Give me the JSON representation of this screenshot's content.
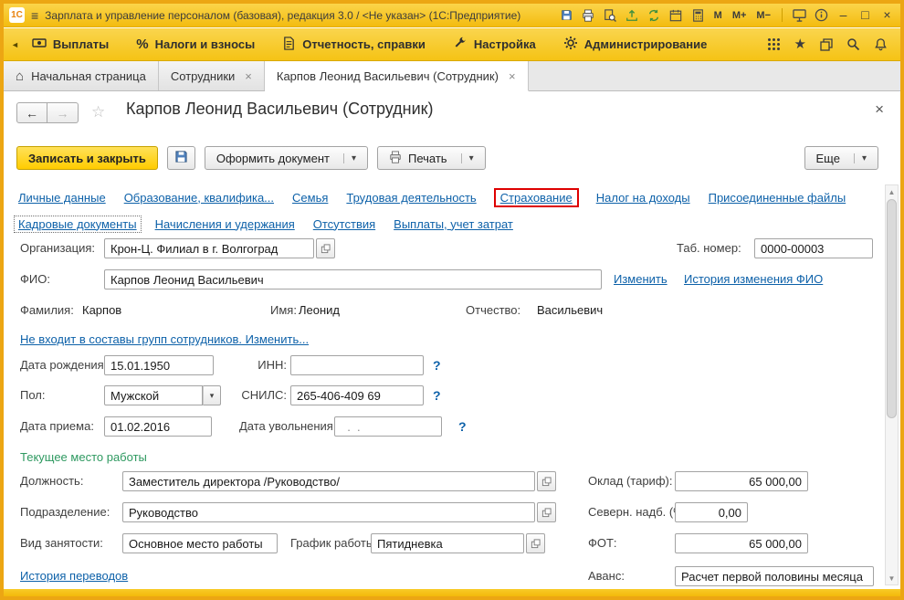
{
  "window": {
    "logo": "1С",
    "title": "Зарплата и управление персоналом (базовая), редакция 3.0 / <Не указан>  (1С:Предприятие)",
    "memory": [
      "М",
      "М+",
      "М−"
    ]
  },
  "icons": {
    "hamburger": "≡",
    "minimize": "–",
    "maximize": "□",
    "close": "×",
    "home": "⌂",
    "favorites_star": "★",
    "star_outline": "☆",
    "back_arrow": "←",
    "forward_arrow": "→",
    "caret_down": "▾",
    "percent": "%",
    "help": "?",
    "scroll_up": "▲",
    "scroll_down": "▼",
    "collapse_left": "◄",
    "tab_close": "×"
  },
  "menubar": {
    "items": [
      {
        "label": "Выплаты"
      },
      {
        "label": "Налоги и взносы"
      },
      {
        "label": "Отчетность, справки"
      },
      {
        "label": "Настройка"
      },
      {
        "label": "Администрирование"
      }
    ]
  },
  "tabbar": {
    "tabs": [
      {
        "label": "Начальная страница"
      },
      {
        "label": "Сотрудники"
      },
      {
        "label": "Карпов Леонид Васильевич (Сотрудник)"
      }
    ]
  },
  "page": {
    "title": "Карпов Леонид Васильевич (Сотрудник)",
    "toolbar": {
      "save_close": "Записать и закрыть",
      "create_document": "Оформить документ",
      "print": "Печать",
      "more": "Еще"
    },
    "nav": {
      "row1": [
        "Личные данные",
        "Образование, квалифика...",
        "Семья",
        "Трудовая деятельность",
        "Страхование",
        "Налог на доходы",
        "Присоединенные файлы"
      ],
      "row2": [
        "Кадровые документы",
        "Начисления и удержания",
        "Отсутствия",
        "Выплаты, учет затрат"
      ]
    },
    "form": {
      "org_label": "Организация:",
      "org_value": "Крон-Ц. Филиал в г. Волгоград",
      "tab_number_label": "Таб. номер:",
      "tab_number_value": "0000-00003",
      "fio_label": "ФИО:",
      "fio_value": "Карпов Леонид Васильевич",
      "change_link": "Изменить",
      "fio_history_link": "История изменения ФИО",
      "surname_label": "Фамилия:",
      "surname_value": "Карпов",
      "firstname_label": "Имя:",
      "firstname_value": "Леонид",
      "patronymic_label": "Отчество:",
      "patronymic_value": "Васильевич",
      "groups_link": "Не входит в составы групп сотрудников. Изменить...",
      "birth_date_label": "Дата рождения:",
      "birth_date_value": "15.01.1950",
      "inn_label": "ИНН:",
      "inn_value": "",
      "gender_label": "Пол:",
      "gender_value": "Мужской",
      "snils_label": "СНИЛС:",
      "snils_value": "265-406-409 69",
      "hire_date_label": "Дата приема:",
      "hire_date_value": "01.02.2016",
      "dismissal_date_label": "Дата увольнения:",
      "dismissal_date_value": "  .  .",
      "section_title": "Текущее место работы",
      "position_label": "Должность:",
      "position_value": "Заместитель директора /Руководство/",
      "salary_label": "Оклад (тариф):",
      "salary_value": "65 000,00",
      "department_label": "Подразделение:",
      "department_value": "Руководство",
      "north_allowance_label": "Северн. надб. (%):",
      "north_allowance_value": "0,00",
      "employment_label": "Вид занятости:",
      "employment_value": "Основное место работы",
      "schedule_label": "График работы:",
      "schedule_value": "Пятидневка",
      "fot_label": "ФОТ:",
      "fot_value": "65 000,00",
      "transfers_link": "История переводов",
      "advance_label": "Аванс:",
      "advance_value": "Расчет первой половины месяца"
    }
  },
  "colors": {
    "frame": "#ECA613",
    "titlebar": "#F7C81F",
    "primary_button": "#FFD21E",
    "link": "#0D61A9",
    "section_title": "#2E9960",
    "highlight_box": "#DE0000"
  }
}
